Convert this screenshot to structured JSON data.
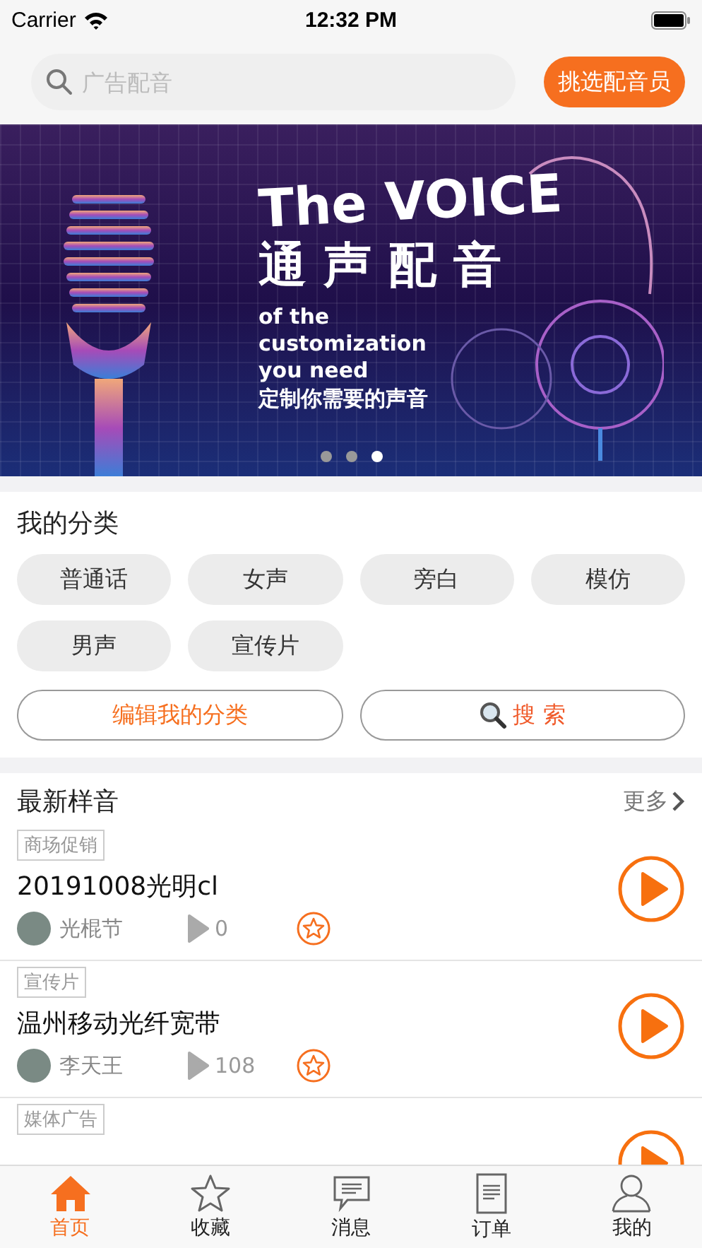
{
  "status_bar": {
    "carrier": "Carrier",
    "time": "12:32 PM"
  },
  "search": {
    "placeholder": "广告配音",
    "action": "挑选配音员"
  },
  "banner": {
    "title": "The VOICE",
    "title_cn": "通声配音",
    "tagline": [
      "of the",
      "customization",
      "you need"
    ],
    "tagline_cn": "定制你需要的声音",
    "dots": [
      {
        "selected": false
      },
      {
        "selected": false
      },
      {
        "selected": true
      }
    ]
  },
  "categories": {
    "title": "我的分类",
    "items": [
      "普通话",
      "女声",
      "旁白",
      "模仿",
      "男声",
      "宣传片"
    ],
    "edit_button": "编辑我的分类",
    "search_button": "搜 索"
  },
  "samples": {
    "title": "最新样音",
    "more": "更多",
    "items": [
      {
        "tag": "商场促销",
        "title": "20191008光明cl",
        "author": "光棍节",
        "plays": "0"
      },
      {
        "tag": "宣传片",
        "title": "温州移动光纤宽带",
        "author": "李天王",
        "plays": "108"
      },
      {
        "tag": "媒体广告"
      }
    ]
  },
  "tab_bar": [
    {
      "label": "首页",
      "kind": "home",
      "selected": true
    },
    {
      "label": "收藏",
      "kind": "star",
      "selected": false
    },
    {
      "label": "消息",
      "kind": "message",
      "selected": false
    },
    {
      "label": "订单",
      "kind": "document",
      "selected": false
    },
    {
      "label": "我的",
      "kind": "person",
      "selected": false
    }
  ]
}
